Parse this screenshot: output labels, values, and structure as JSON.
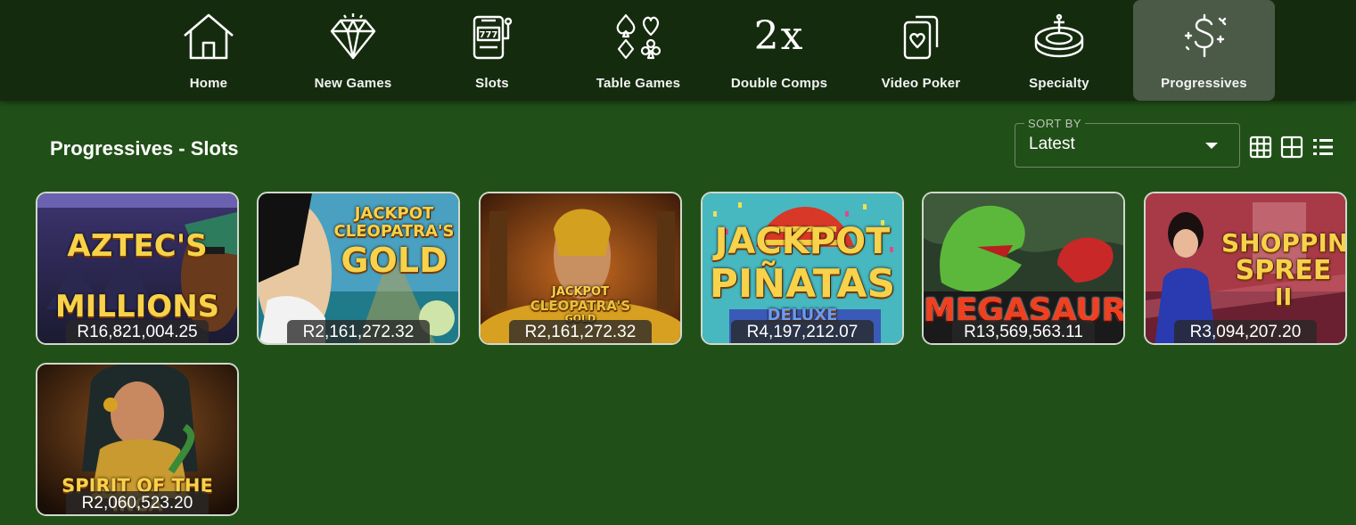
{
  "nav": {
    "items": [
      {
        "label": "Home",
        "icon": "home-icon"
      },
      {
        "label": "New Games",
        "icon": "diamond-icon"
      },
      {
        "label": "Slots",
        "icon": "slot-machine-icon"
      },
      {
        "label": "Table Games",
        "icon": "card-suits-icon"
      },
      {
        "label": "Double Comps",
        "icon": "double-comps-icon",
        "icon_text": "2x"
      },
      {
        "label": "Video Poker",
        "icon": "playing-cards-icon"
      },
      {
        "label": "Specialty",
        "icon": "roulette-icon"
      },
      {
        "label": "Progressives",
        "icon": "dollar-sparkle-icon",
        "active": true
      }
    ]
  },
  "page": {
    "title": "Progressives - Slots"
  },
  "sort": {
    "legend": "SORT BY",
    "value": "Latest"
  },
  "view_options": [
    "grid-small-icon",
    "grid-large-icon",
    "list-view-icon"
  ],
  "games": [
    {
      "name_lines": [
        "AZTEC'S",
        "MILLIONS"
      ],
      "jackpot": "R16,821,004.25"
    },
    {
      "name_lines": [
        "JACKPOT",
        "CLEOPATRA'S",
        "GOLD"
      ],
      "jackpot": "R2,161,272.32"
    },
    {
      "name_lines": [
        "JACKPOT",
        "CLEOPATRA'S",
        "GOLD"
      ],
      "jackpot": "R2,161,272.32"
    },
    {
      "name_lines": [
        "JACKPOT",
        "PIÑATAS",
        "DELUXE"
      ],
      "jackpot": "R4,197,212.07"
    },
    {
      "name_lines": [
        "MEGASAUR"
      ],
      "jackpot": "R13,569,563.11"
    },
    {
      "name_lines": [
        "SHOPPING",
        "SPREE",
        "II"
      ],
      "jackpot": "R3,094,207.20"
    },
    {
      "name_lines": [
        "SPIRIT OF THE INCA"
      ],
      "jackpot": "R2,060,523.20"
    }
  ],
  "colors": {
    "background": "#214f18",
    "nav_background": "#152b0e",
    "nav_active": "#4a5a47",
    "tile_border": "#d0d8cc"
  }
}
